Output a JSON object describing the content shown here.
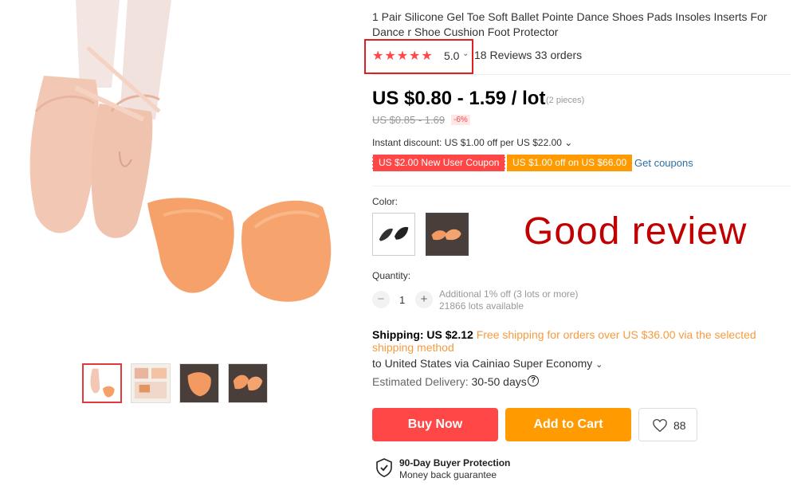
{
  "product": {
    "title": "1 Pair Silicone Gel Toe Soft Ballet Pointe Dance Shoes Pads Insoles Inserts For Dance r Shoe Cushion Foot Protector",
    "rating": {
      "stars": "★★★★★",
      "value": "5.0",
      "reviews": "18 Reviews",
      "orders": "33 orders"
    },
    "price": {
      "current": "US $0.80 - 1.59 / lot",
      "pieces": "(2 pieces)",
      "original": "US $0.85 - 1.69",
      "discount": "-6%"
    },
    "instant_discount": "Instant discount: US $1.00 off per US $22.00",
    "coupons": [
      "US $2.00 New User Coupon",
      "US $1.00 off on US $66.00"
    ],
    "get_coupons": "Get coupons",
    "color_label": "Color:",
    "colors": [
      "black",
      "skin"
    ],
    "overlay_text": "Good review",
    "quantity": {
      "label": "Quantity:",
      "value": "1",
      "info": "Additional 1% off (3 lots or more)",
      "available": "21866 lots available"
    },
    "shipping": {
      "label": "Shipping: US $2.12",
      "free": "Free shipping for orders over US $36.00 via the selected shipping method",
      "to": "to United States via Cainiao Super Economy",
      "delivery_label": "Estimated Delivery:",
      "delivery_value": "30-50 days"
    },
    "buttons": {
      "buy": "Buy Now",
      "cart": "Add to Cart",
      "wishlist_count": "88"
    },
    "protection": {
      "title": "90-Day Buyer Protection",
      "subtitle": "Money back guarantee"
    }
  },
  "colors": {
    "accent": "#ff4747",
    "orange": "#ff9a00",
    "link": "#2c6fa6",
    "overlay": "#c00000"
  },
  "icons": [
    "star-icon",
    "caret-down-icon",
    "minus-icon",
    "plus-icon",
    "help-icon",
    "heart-icon",
    "shield-check-icon"
  ]
}
